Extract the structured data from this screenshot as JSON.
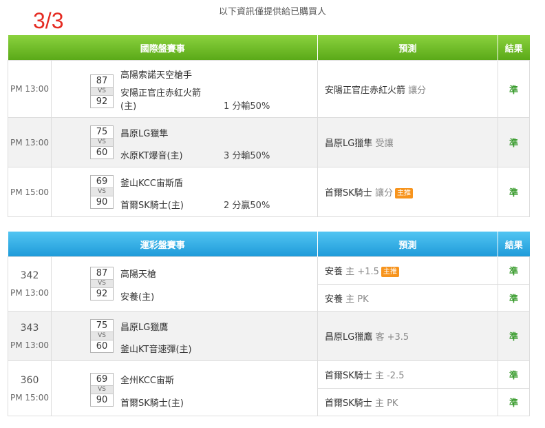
{
  "notice": "以下資訊僅提供給已購買人",
  "page_indicator": "3/3",
  "tables": [
    {
      "header": {
        "match": "國際盤賽事",
        "prediction": "預測",
        "result": "結果"
      },
      "rows": [
        {
          "time": "PM 13:00",
          "away_score": "87",
          "vs": "VS",
          "home_score": "92",
          "away": "高陽索諾天空槍手",
          "home_line1": "安陽正官庄赤紅火箭",
          "home_line2": "(主)",
          "handicap": "1 分輸50%",
          "pred_team": "安陽正官庄赤紅火箭",
          "pred_type": "讓分",
          "badge": "",
          "result": "準"
        },
        {
          "time": "PM 13:00",
          "away_score": "75",
          "vs": "VS",
          "home_score": "60",
          "away": "昌原LG獵隼",
          "home_line1": "水原KT爆音(主)",
          "handicap": "3 分輸50%",
          "pred_team": "昌原LG獵隼",
          "pred_type": "受讓",
          "badge": "",
          "result": "準"
        },
        {
          "time": "PM 15:00",
          "away_score": "69",
          "vs": "VS",
          "home_score": "90",
          "away": "釜山KCC宙斯盾",
          "home_line1": "首爾SK騎士(主)",
          "handicap": "2 分贏50%",
          "pred_team": "首爾SK騎士",
          "pred_type": "讓分",
          "badge": "主推",
          "result": "準"
        }
      ]
    },
    {
      "header": {
        "match": "運彩盤賽事",
        "prediction": "預測",
        "result": "結果"
      },
      "rows": [
        {
          "game_no": "342",
          "time": "PM 13:00",
          "away_score": "87",
          "vs": "VS",
          "home_score": "92",
          "away": "高陽天槍",
          "home": "安養(主)",
          "preds": [
            {
              "team": "安養",
              "side": "主",
              "line": "+1.5",
              "badge": "主推",
              "result": "準"
            },
            {
              "team": "安養",
              "side": "主",
              "line": "PK",
              "badge": "",
              "result": "準"
            }
          ]
        },
        {
          "game_no": "343",
          "time": "PM 13:00",
          "away_score": "75",
          "vs": "VS",
          "home_score": "60",
          "away": "昌原LG獵鷹",
          "home": "釜山KT音速彈(主)",
          "preds": [
            {
              "team": "昌原LG獵鷹",
              "side": "客",
              "line": "+3.5",
              "badge": "",
              "result": "準"
            }
          ]
        },
        {
          "game_no": "360",
          "time": "PM 15:00",
          "away_score": "69",
          "vs": "VS",
          "home_score": "90",
          "away": "全州KCC宙斯",
          "home": "首爾SK騎士(主)",
          "preds": [
            {
              "team": "首爾SK騎士",
              "side": "主",
              "line": "-2.5",
              "badge": "",
              "result": "準"
            },
            {
              "team": "首爾SK騎士",
              "side": "主",
              "line": "PK",
              "badge": "",
              "result": "準"
            }
          ]
        }
      ]
    }
  ]
}
